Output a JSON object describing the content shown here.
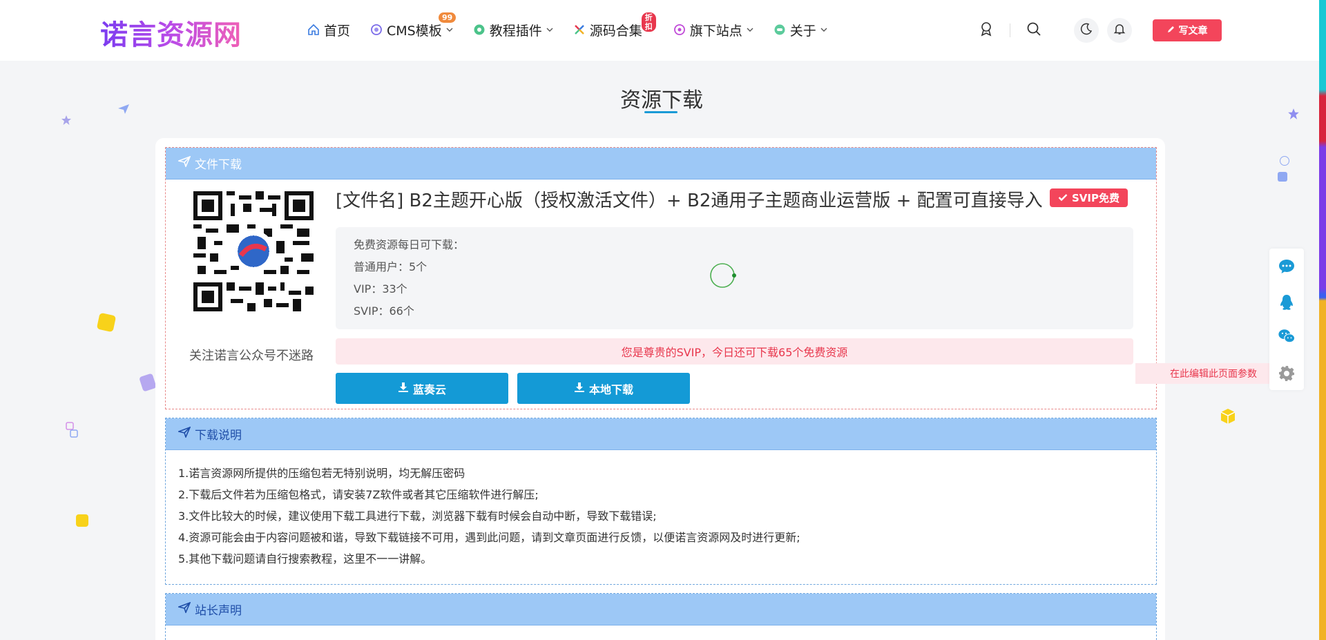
{
  "header": {
    "logo_text": "诺言资源网",
    "nav": [
      {
        "label": "首页",
        "icon": "home-icon"
      },
      {
        "label": "CMS模板",
        "icon": "template-icon",
        "badge": "99"
      },
      {
        "label": "教程插件",
        "icon": "plugin-icon"
      },
      {
        "label": "源码合集",
        "icon": "code-icon",
        "badge": "折扣"
      },
      {
        "label": "旗下站点",
        "icon": "site-icon"
      },
      {
        "label": "关于",
        "icon": "about-icon"
      }
    ],
    "write_button": "写文章"
  },
  "page_title": "资源下载",
  "file_section": {
    "heading": "文件下载",
    "qr_caption": "关注诺言公众号不迷路",
    "file_title": "[文件名] B2主题开心版（授权激活文件）+ B2通用子主题商业运营版 + 配置可直接导入",
    "tag": "SVIP免费",
    "quota": {
      "line1": "免费资源每日可下载：",
      "line2": "普通用户：5个",
      "line3": "VIP：33个",
      "line4": "SVIP：66个"
    },
    "notice": "您是尊贵的SVIP，今日还可下载65个免费资源",
    "buttons": {
      "lanzou": "蓝奏云",
      "local": "本地下载"
    }
  },
  "instructions": {
    "heading": "下载说明",
    "rows": [
      "1.诺言资源网所提供的压缩包若无特别说明，均无解压密码",
      "2.下载后文件若为压缩包格式，请安装7Z软件或者其它压缩软件进行解压;",
      "3.文件比较大的时候，建议使用下载工具进行下载，浏览器下载有时候会自动中断，导致下载错误;",
      "4.资源可能会由于内容问题被和谐，导致下载链接不可用，遇到此问题，请到文章页面进行反馈，以便诺言资源网及时进行更新;",
      "5.其他下载问题请自行搜索教程，这里不一一讲解。"
    ]
  },
  "statement": {
    "heading": "站长声明"
  },
  "side": {
    "edit_tip": "在此编辑此页面参数"
  },
  "colors": {
    "accent_red": "#f3455b",
    "accent_blue": "#149ad6",
    "head_blue": "#9dc8f6"
  }
}
